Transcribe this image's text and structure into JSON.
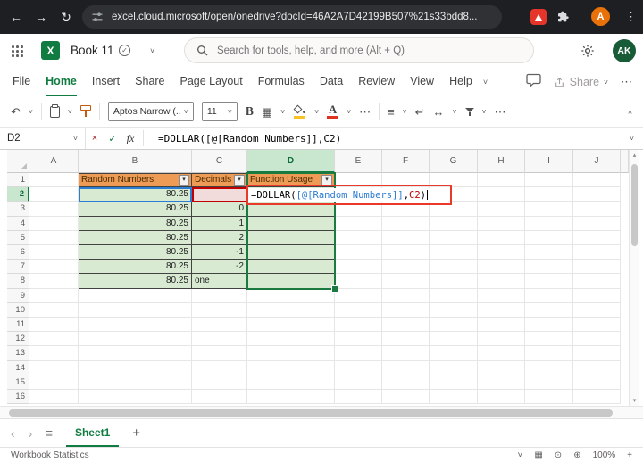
{
  "browser": {
    "url": "excel.cloud.microsoft/open/onedrive?docId=46A2A7D42199B507%21s33bdd8...",
    "profile_initial": "A"
  },
  "app_header": {
    "logo_letter": "X",
    "doc_title": "Book 11",
    "search_placeholder": "Search for tools, help, and more (Alt + Q)",
    "profile_initials": "AK"
  },
  "ribbon_tabs": {
    "items": [
      "File",
      "Home",
      "Insert",
      "Share",
      "Page Layout",
      "Formulas",
      "Data",
      "Review",
      "View",
      "Help"
    ],
    "active": "Home",
    "share_label": "Share"
  },
  "toolbar": {
    "font_name": "Aptos Narrow (...",
    "font_size": "11",
    "bold_label": "B",
    "font_color_label": "A"
  },
  "formula_bar": {
    "name_box": "D2",
    "fx_label": "fx",
    "formula": "=DOLLAR([@[Random Numbers]],C2)"
  },
  "grid": {
    "columns": [
      "A",
      "B",
      "C",
      "D",
      "E",
      "F",
      "G",
      "H",
      "I",
      "J"
    ],
    "row_numbers": [
      "1",
      "2",
      "3",
      "4",
      "5",
      "6",
      "7",
      "8",
      "9",
      "10",
      "11",
      "12",
      "13",
      "14",
      "15",
      "16"
    ],
    "selected_column": "D",
    "selected_row": "2",
    "table": {
      "headers": [
        "Random Numbers",
        "Decimals",
        "Function Usage"
      ],
      "rows": [
        {
          "random_numbers": "80.25",
          "decimals": "",
          "function_usage": ""
        },
        {
          "random_numbers": "80.25",
          "decimals": "0",
          "function_usage": ""
        },
        {
          "random_numbers": "80.25",
          "decimals": "1",
          "function_usage": ""
        },
        {
          "random_numbers": "80.25",
          "decimals": "2",
          "function_usage": ""
        },
        {
          "random_numbers": "80.25",
          "decimals": "-1",
          "function_usage": ""
        },
        {
          "random_numbers": "80.25",
          "decimals": "-2",
          "function_usage": ""
        },
        {
          "random_numbers": "80.25",
          "decimals": "one",
          "function_usage": ""
        }
      ]
    },
    "editing": {
      "cell": "D2",
      "formula_parts": [
        {
          "text": "=DOLLAR(",
          "color": "#000000"
        },
        {
          "text": "[@[Random Numbers]]",
          "color": "#2B7CD3"
        },
        {
          "text": ",",
          "color": "#000000"
        },
        {
          "text": "C2",
          "color": "#C00000"
        },
        {
          "text": ")",
          "color": "#000000"
        }
      ]
    }
  },
  "sheet_bar": {
    "sheets": [
      "Sheet1"
    ],
    "active_sheet": "Sheet1"
  },
  "status_bar": {
    "left_text": "Workbook Statistics",
    "zoom_level": "100%"
  },
  "colors": {
    "accent_green": "#107C41",
    "table_header_orange": "#EE9B55",
    "table_fill_green": "#D8EAD2",
    "reference_blue": "#2B7CD3",
    "reference_red": "#C00000",
    "annotation_red": "#E8392B",
    "fill_swatch": "#F7C325",
    "font_color_swatch": "#E0301E",
    "browser_avatar_orange": "#E8710A",
    "app_avatar_green": "#185C37"
  },
  "icons": {
    "back": "←",
    "forward": "→",
    "refresh": "↻",
    "browser_menu": "⋮",
    "chevron_down": "˅",
    "chevron_up": "˄",
    "saved_check": "✓",
    "undo": "↶",
    "borders": "▦",
    "align": "≡",
    "wrap": "↵",
    "merge": "↔",
    "more": "⋯",
    "cancel": "×",
    "enter": "✓",
    "tab_prev": "‹",
    "tab_next": "›",
    "sheet_menu": "≡",
    "add": "+",
    "scroll_up": "▴",
    "scroll_down": "▾",
    "filter_caret": "▾",
    "keypad": "▦",
    "circle_dot": "⊙",
    "circle_plus": "⊕",
    "zoom_in": "+"
  }
}
